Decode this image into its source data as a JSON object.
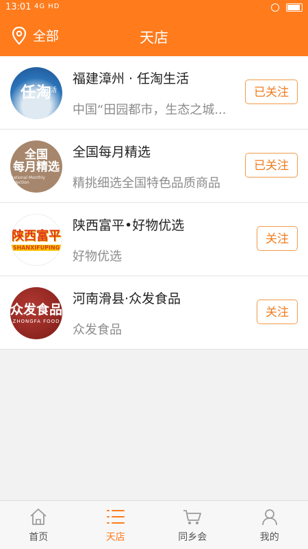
{
  "status_bar": {
    "time": "13:01",
    "network": "4G HD",
    "battery": ""
  },
  "header": {
    "location": "全部",
    "title": "天店"
  },
  "shops": [
    {
      "name": "福建漳州 · 任淘生活",
      "desc": "中国“田园都市，生态之城...",
      "follow_label": "已关注",
      "logo_main": "任淘",
      "logo_sub": "生活"
    },
    {
      "name": "全国每月精选",
      "desc": "精挑细选全国特色品质商品",
      "follow_label": "已关注",
      "logo_line1": "全国",
      "logo_line2": "每月精选",
      "logo_line3": "National Monthly Selection"
    },
    {
      "name": "陕西富平•好物优选",
      "desc": "好物优选",
      "follow_label": "关注",
      "logo_cn": "陕西富平",
      "logo_en": "SHANXIFUPING"
    },
    {
      "name": "河南滑县·众发食品",
      "desc": "众发食品",
      "follow_label": "关注",
      "logo_cn": "众发食品",
      "logo_en": "ZHONGFA FOOD"
    }
  ],
  "tabs": [
    {
      "label": "首页",
      "icon": "home-icon",
      "active": false
    },
    {
      "label": "天店",
      "icon": "list-icon",
      "active": true
    },
    {
      "label": "同乡会",
      "icon": "cart-icon",
      "active": false
    },
    {
      "label": "我的",
      "icon": "person-icon",
      "active": false
    }
  ],
  "colors": {
    "accent": "#ff7b1c",
    "follow_border": "#f39a4a",
    "background": "#f2f2f2"
  }
}
